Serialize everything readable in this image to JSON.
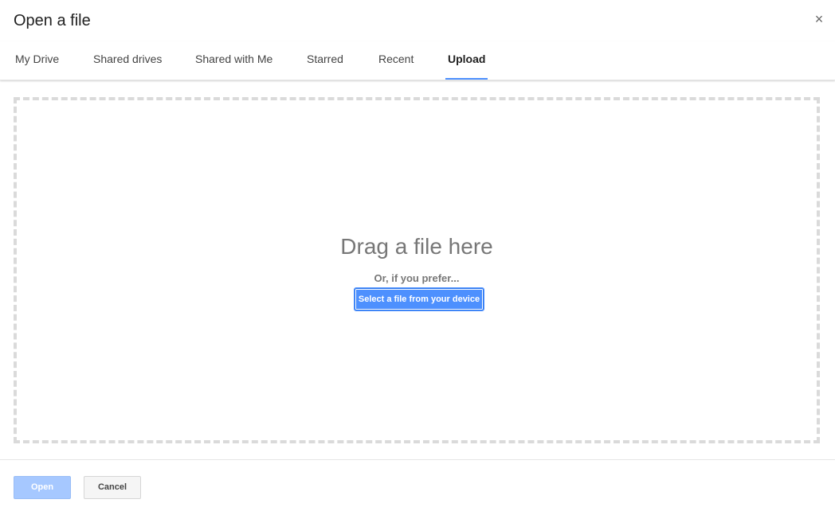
{
  "dialog": {
    "title": "Open a file",
    "close_label": "×"
  },
  "tabs": [
    {
      "label": "My Drive",
      "active": false
    },
    {
      "label": "Shared drives",
      "active": false
    },
    {
      "label": "Shared with Me",
      "active": false
    },
    {
      "label": "Starred",
      "active": false
    },
    {
      "label": "Recent",
      "active": false
    },
    {
      "label": "Upload",
      "active": true
    }
  ],
  "upload": {
    "drag_text": "Drag a file here",
    "prefer_text": "Or, if you prefer...",
    "select_label": "Select a file from your device"
  },
  "footer": {
    "open_label": "Open",
    "cancel_label": "Cancel"
  },
  "colors": {
    "accent": "#4d90fe",
    "open_disabled": "#a6c8ff",
    "dropzone_border": "#dadada"
  }
}
